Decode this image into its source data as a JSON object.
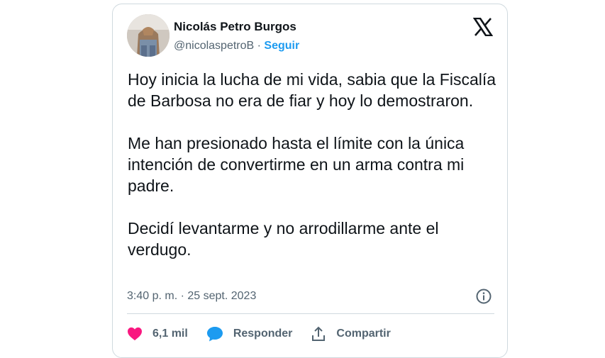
{
  "author": {
    "name": "Nicolás Petro Burgos",
    "handle": "@nicolaspetroB",
    "separator": "·",
    "follow_label": "Seguir"
  },
  "tweet": {
    "paragraph_1": "Hoy inicia la lucha de mi vida, sabia que la Fiscalía de Barbosa no era de fiar y hoy lo demostraron.",
    "paragraph_2": "Me han presionado hasta el límite con la única intención de convertirme en un arma contra mi padre.",
    "paragraph_3": "Decidí levantarme y no arrodillarme  ante el verdugo.",
    "timestamp": "3:40 p. m. · 25 sept. 2023"
  },
  "actions": {
    "likes": "6,1 mil",
    "reply_label": "Responder",
    "share_label": "Compartir"
  },
  "icons": {
    "platform": "x-logo-icon",
    "info": "info-icon",
    "like": "heart-icon",
    "reply": "speech-bubble-icon",
    "share": "share-icon"
  },
  "colors": {
    "accent": "#1d9bf0",
    "like": "#f91880",
    "muted_text": "#536471",
    "border": "#cfd9de"
  }
}
